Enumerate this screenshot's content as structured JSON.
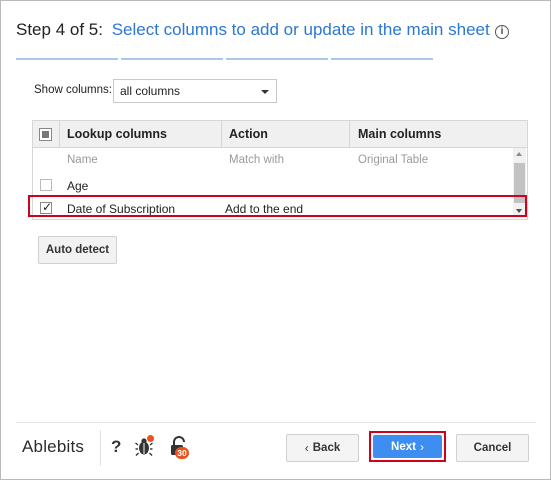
{
  "header": {
    "step": "Step 4 of 5:",
    "title": "Select columns to add or update in the main sheet",
    "info_icon": "info-icon",
    "progress_segments": 4
  },
  "show_columns": {
    "label": "Show columns:",
    "selected": "all columns"
  },
  "table": {
    "headers": [
      "Lookup columns",
      "Action",
      "Main columns"
    ],
    "subheader": {
      "lookup": "Name",
      "action": "Match with",
      "main": "Original Table"
    },
    "rows": [
      {
        "checked": false,
        "lookup": "Age",
        "action": "",
        "main": ""
      },
      {
        "checked": true,
        "lookup": "Date of Subscription",
        "action": "Add to the end",
        "main": ""
      }
    ]
  },
  "buttons": {
    "auto_detect": "Auto detect",
    "back": "Back",
    "next": "Next",
    "cancel": "Cancel"
  },
  "footer": {
    "brand": "Ablebits",
    "help": "?",
    "badge_count": "30"
  },
  "colors": {
    "accent": "#2b78d3",
    "primary_button": "#3d8ef0",
    "highlight": "#d0021b",
    "badge": "#e8541c"
  }
}
